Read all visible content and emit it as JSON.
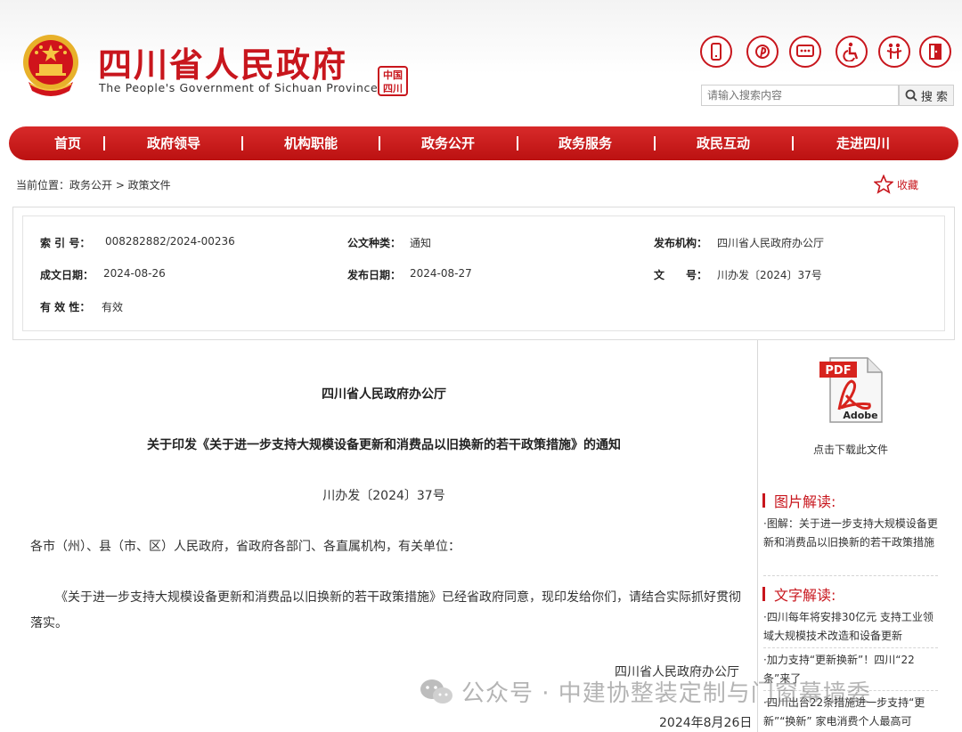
{
  "header": {
    "title": "四川省人民政府",
    "subtitle": "The People's Government of Sichuan Province",
    "seal_text": "中国四川",
    "tool_icons": [
      "mobile-icon",
      "weibo-icon",
      "wechat-icon",
      "accessibility-icon",
      "elderly-care-icon",
      "exit-icon"
    ],
    "search": {
      "placeholder": "请输入搜索内容",
      "button_label": "搜 索"
    }
  },
  "nav": {
    "items": [
      "首页",
      "政府领导",
      "机构职能",
      "政务公开",
      "政务服务",
      "政民互动",
      "走进四川"
    ]
  },
  "breadcrumb": {
    "text": "当前位置：政务公开 > 政策文件"
  },
  "favorite": {
    "label": "收藏"
  },
  "meta": {
    "index_label": "索 引 号：",
    "index_value": "008282882/2024-00236",
    "category_label": "公文种类：",
    "category_value": "通知",
    "publisher_label": "发布机构：",
    "publisher_value": "四川省人民政府办公厅",
    "created_label": "成文日期：",
    "created_value": "2024-08-26",
    "published_label": "发布日期：",
    "published_value": "2024-08-27",
    "docno_label": "文　　号：",
    "docno_value": "川办发〔2024〕37号",
    "validity_label": "有 效 性：",
    "validity_value": "有效"
  },
  "document": {
    "org": "四川省人民政府办公厅",
    "title": "关于印发《关于进一步支持大规模设备更新和消费品以旧换新的若干政策措施》的通知",
    "number": "川办发〔2024〕37号",
    "salutation": "各市（州）、县（市、区）人民政府，省政府各部门、各直属机构，有关单位：",
    "body": "《关于进一步支持大规模设备更新和消费品以旧换新的若干政策措施》已经省政府同意，现印发给你们，请结合实际抓好贯彻落实。",
    "signature": "四川省人民政府办公厅",
    "date": "2024年8月26日"
  },
  "sidebar": {
    "pdf_label": "PDF",
    "pdf_brand": "Adobe",
    "download_caption": "点击下载此文件",
    "picture_heading": "图片解读:",
    "picture_links": [
      "·图解：关于进一步支持大规模设备更新和消费品以旧换新的若干政策措施"
    ],
    "text_heading": "文字解读:",
    "text_links": [
      "·四川每年将安排30亿元 支持工业领域大规模技术改造和设备更新",
      "·加力支持“更新换新”！四川“22条”来了",
      "·四川出台22条措施进一步支持“更新”“换新” 家电消费个人最高可"
    ]
  },
  "watermark": {
    "text": "公众号 · 中建协整装定制与门窗幕墙委"
  },
  "colors": {
    "brand_red": "#c8161d",
    "nav_red": "#c41a1a"
  }
}
